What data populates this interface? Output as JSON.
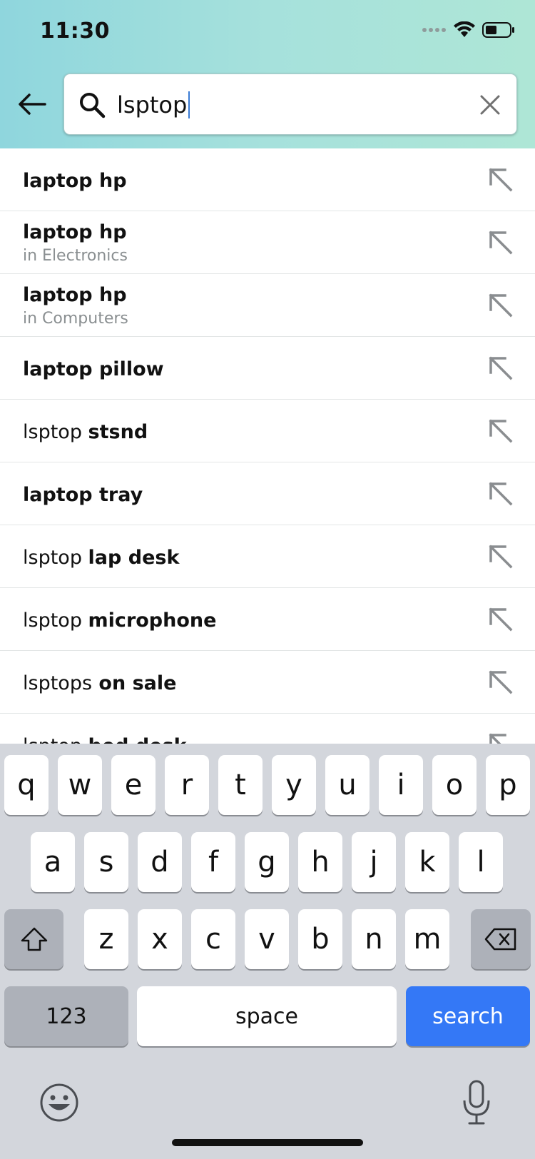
{
  "status_bar": {
    "time": "11:30"
  },
  "search": {
    "query": "lsptop"
  },
  "suggestions": [
    {
      "plain": "",
      "bold": "laptop hp",
      "sub": ""
    },
    {
      "plain": "",
      "bold": "laptop hp",
      "sub": "in Electronics"
    },
    {
      "plain": "",
      "bold": "laptop hp",
      "sub": "in Computers"
    },
    {
      "plain": "",
      "bold": "laptop pillow",
      "sub": ""
    },
    {
      "plain": "lsptop ",
      "bold": "stsnd",
      "sub": ""
    },
    {
      "plain": "",
      "bold": "laptop tray",
      "sub": ""
    },
    {
      "plain": "lsptop ",
      "bold": "lap desk",
      "sub": ""
    },
    {
      "plain": "lsptop ",
      "bold": "microphone",
      "sub": ""
    },
    {
      "plain": "lsptops",
      "bold": " on sale",
      "sub": ""
    },
    {
      "plain": "lsptop ",
      "bold": "bed desk",
      "sub": ""
    }
  ],
  "keyboard": {
    "row1": [
      "q",
      "w",
      "e",
      "r",
      "t",
      "y",
      "u",
      "i",
      "o",
      "p"
    ],
    "row2": [
      "a",
      "s",
      "d",
      "f",
      "g",
      "h",
      "j",
      "k",
      "l"
    ],
    "row3": [
      "z",
      "x",
      "c",
      "v",
      "b",
      "n",
      "m"
    ],
    "numbers_label": "123",
    "space_label": "space",
    "search_label": "search"
  },
  "colors": {
    "accent": "#3478f6",
    "header_start": "#8fd6dd",
    "header_end": "#aee6d6"
  }
}
